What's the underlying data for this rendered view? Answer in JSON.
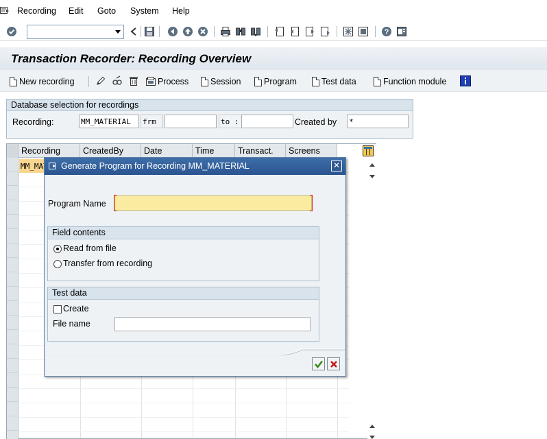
{
  "menubar": {
    "items": [
      {
        "label": "Recording",
        "mnemonic": "R",
        "rest": "ecording"
      },
      {
        "label": "Edit",
        "mnemonic": "E",
        "rest": "dit"
      },
      {
        "label": "Goto",
        "mnemonic": "G",
        "rest": "oto"
      },
      {
        "label": "System",
        "mnemonic": "S",
        "rest": "ystem"
      },
      {
        "label": "Help",
        "mnemonic": "H",
        "rest": "elp"
      }
    ]
  },
  "stdbar": {
    "command_value": "",
    "icons": [
      "enter-icon",
      "back-icon",
      "save-icon",
      "back-nav-icon",
      "exit-icon",
      "cancel-icon",
      "print-icon",
      "find-icon",
      "find-next-icon",
      "first-page-icon",
      "previous-page-icon",
      "next-page-icon",
      "last-page-icon",
      "create-session-icon",
      "shortcut-icon",
      "help-icon",
      "layout-menu-icon"
    ]
  },
  "title": "Transaction Recorder: Recording Overview",
  "appbar": {
    "new_recording": "New recording",
    "process": "Process",
    "session": "Session",
    "program": "Program",
    "test_data": "Test data",
    "function_module": "Function module"
  },
  "selection": {
    "header": "Database selection for recordings",
    "recording_label": "Recording:",
    "recording_value": "MM_MATERIAL",
    "from_label": "frm",
    "from_value": "",
    "to_label": "to :",
    "to_value": "",
    "created_by_label": "Created by",
    "created_by_value": "*"
  },
  "grid": {
    "columns": [
      "Recording",
      "CreatedBy",
      "Date",
      "Time",
      "Transact.",
      "Screens"
    ],
    "rows": [
      {
        "recording": "MM_MATERIAL"
      }
    ]
  },
  "dialog": {
    "title": "Generate Program for Recording MM_MATERIAL",
    "program_name_label": "Program Name",
    "program_name_value": "",
    "field_contents_header": "Field contents",
    "option_read": "Read from file",
    "option_transfer": "Transfer from recording",
    "selected_option": "read",
    "test_data_header": "Test data",
    "create_label": "Create",
    "create_checked": false,
    "file_name_label": "File name",
    "file_name_value": ""
  },
  "colors": {
    "dialog_title_bg": "#2b5591",
    "required_field_bg": "#fbeba0",
    "selected_row_bg": "#f9d68f",
    "ok_green": "#3a8a1f",
    "cancel_red": "#c0171b"
  }
}
